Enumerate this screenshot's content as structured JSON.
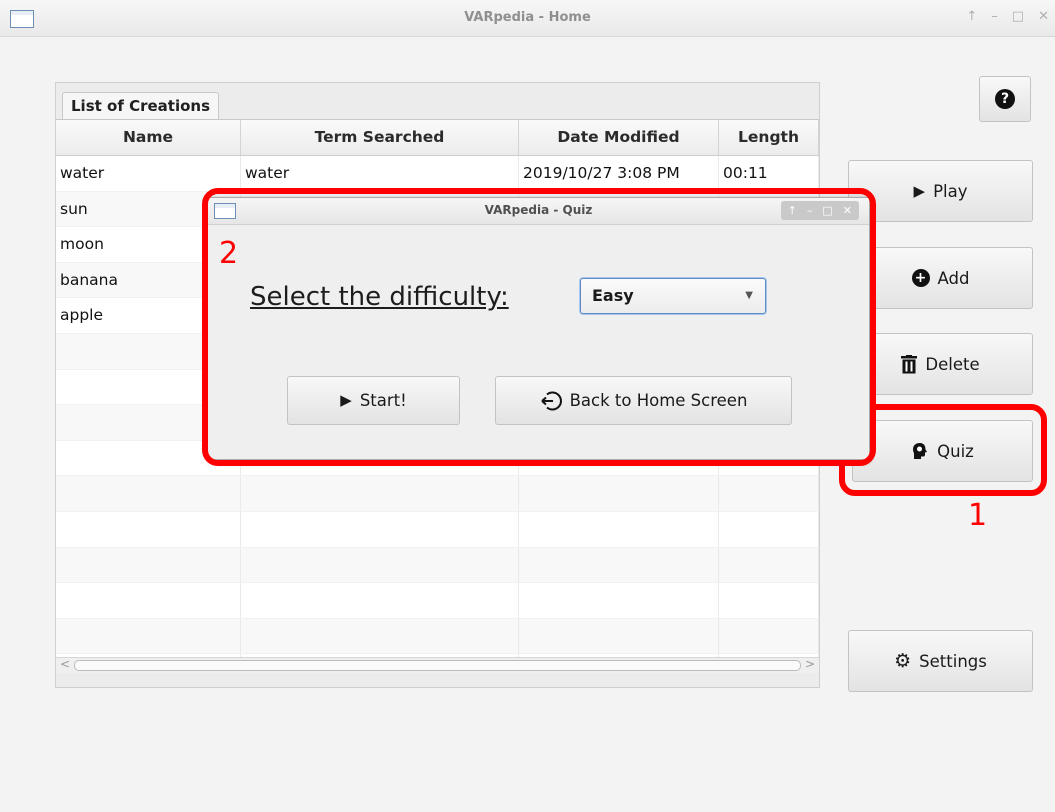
{
  "window": {
    "title": "VARpedia - Home",
    "controls": [
      "↑",
      "–",
      "□",
      "✕"
    ]
  },
  "panel": {
    "tab_label": "List of Creations",
    "columns": [
      "Name",
      "Term Searched",
      "Date Modified",
      "Length"
    ],
    "rows": [
      [
        "water",
        "water",
        "2019/10/27 3:08 PM",
        "00:11"
      ],
      [
        "sun",
        "",
        "",
        ""
      ],
      [
        "moon",
        "",
        "",
        ""
      ],
      [
        "banana",
        "",
        "",
        ""
      ],
      [
        "apple",
        "",
        "",
        ""
      ],
      [
        "",
        "",
        "",
        ""
      ],
      [
        "",
        "",
        "",
        ""
      ],
      [
        "",
        "",
        "",
        ""
      ],
      [
        "",
        "",
        "",
        ""
      ],
      [
        "",
        "",
        "",
        ""
      ],
      [
        "",
        "",
        "",
        ""
      ],
      [
        "",
        "",
        "",
        ""
      ],
      [
        "",
        "",
        "",
        ""
      ],
      [
        "",
        "",
        "",
        ""
      ],
      [
        "",
        "",
        "",
        ""
      ]
    ],
    "scroll_left": "<",
    "scroll_right": ">"
  },
  "side_buttons": {
    "help": "?",
    "play": "Play",
    "add": "Add",
    "delete": "Delete",
    "quiz": "Quiz",
    "settings": "Settings"
  },
  "annotations": {
    "label_1": "1",
    "label_2": "2",
    "color": "#ff0000"
  },
  "quiz_dialog": {
    "title": "VARpedia - Quiz",
    "controls": [
      "↑",
      "–",
      "□",
      "✕"
    ],
    "difficulty_label": "Select the difficulty:",
    "difficulty_value": "Easy",
    "start_label": "Start!",
    "back_label": "Back to Home Screen"
  }
}
